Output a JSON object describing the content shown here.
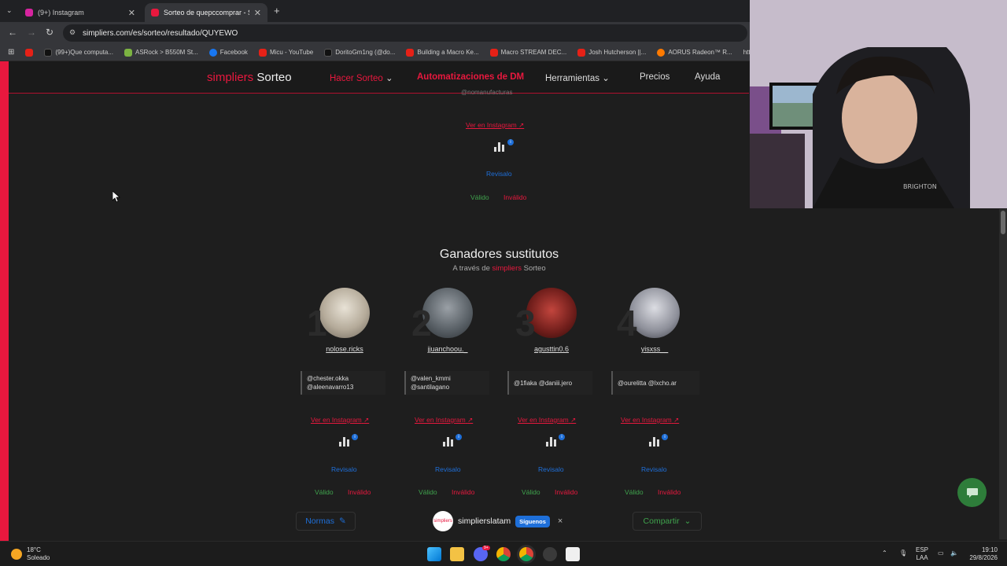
{
  "browser": {
    "tabs": [
      {
        "title": "(9+) Instagram",
        "color": "#d6249f"
      },
      {
        "title": "Sorteo de quepccomprar - Simp",
        "color": "#e8183e"
      }
    ],
    "new_tab": "+",
    "url": "simpliers.com/es/sorteo/resultado/QUYEWO",
    "bookmarks": [
      "(99+)Que computa...",
      "ASRock > B550M St...",
      "Facebook",
      "Micu - YouTube",
      "DoritoGm1ng (@do...",
      "Building a Macro Ke...",
      "Macro STREAM DEC...",
      "Josh Hutcherson ||...",
      "AORUS Radeon™ R...",
      "https"
    ]
  },
  "site": {
    "logo_brand": "simpliers",
    "logo_product": " Sorteo",
    "nav": {
      "hacer_sorteo": "Hacer Sorteo",
      "automatizaciones": "Automatizaciones de DM",
      "herramientas": "Herramientas",
      "precios": "Precios",
      "ayuda": "Ayuda"
    },
    "top_winner": {
      "mention": "@nomanufacturas",
      "instagram_link": "Ver en Instagram",
      "revisalo": "Revisalo",
      "valido": "Válido",
      "invalido": "Inválido"
    },
    "substitutes": {
      "title": "Ganadores sustitutos",
      "subtitle_prefix": "A través de ",
      "subtitle_brand": "simpliers",
      "subtitle_suffix": " Sorteo",
      "winners": [
        {
          "rank": "1",
          "username": "nolose.ricks",
          "mentions_1": "@chester.okka",
          "mentions_2": "@aleenavarro13"
        },
        {
          "rank": "2",
          "username": "jjuanchoou._",
          "mentions_1": "@valen_kmmi",
          "mentions_2": "@santilagano"
        },
        {
          "rank": "3",
          "username": "agusttin0.6",
          "mentions_1": "@1fiaka @daniii.jero",
          "mentions_2": ""
        },
        {
          "rank": "4",
          "username": "yisxss__",
          "mentions_1": "@ourelitta @lxcho.ar",
          "mentions_2": ""
        }
      ],
      "instagram_link": "Ver en Instagram",
      "info_badge": "i",
      "revisalo": "Revisalo",
      "valido": "Válido",
      "invalido": "Inválido"
    },
    "footer": {
      "normas": "Normas",
      "follow_account": "simplierslatam",
      "follow_logo": "simpliers",
      "follow_button": "Síguenos",
      "close": "×",
      "compartir": "Compartir"
    }
  },
  "taskbar": {
    "temperature": "18°C",
    "weather": "Soleado",
    "lang_1": "ESP",
    "lang_2": "LAA",
    "time": "19:10",
    "date": "29/8/2026",
    "discord_badge": "9+"
  }
}
